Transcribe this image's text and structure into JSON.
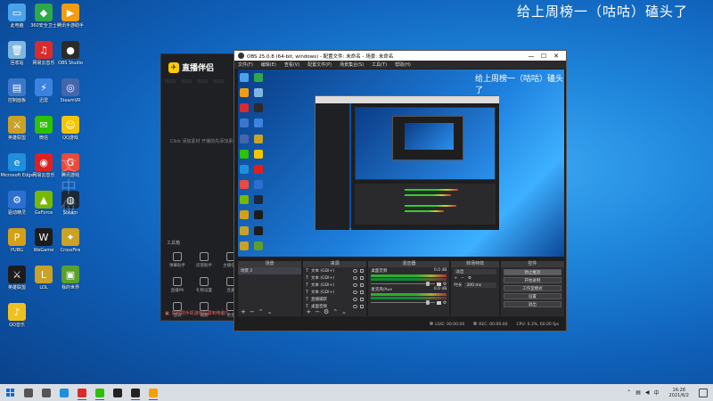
{
  "desktop": {
    "title_overlay": "给上周榜一（咕咕）磕头了",
    "watermark": "文中位",
    "icons": [
      {
        "label": "此电脑",
        "color": "#4aa3e8",
        "glyph": "▭"
      },
      {
        "label": "360安全卫士",
        "color": "#2ea84a",
        "glyph": "◆"
      },
      {
        "label": "腾讯手游助手",
        "color": "#f39c12",
        "glyph": "▶"
      },
      {
        "label": "回收站",
        "color": "#7fb6e0",
        "glyph": "🗑"
      },
      {
        "label": "网易云音乐",
        "color": "#d92b2b",
        "glyph": "♫"
      },
      {
        "label": "OBS Studio",
        "color": "#2b2b2b",
        "glyph": "●"
      },
      {
        "label": "控制面板",
        "color": "#3b78c9",
        "glyph": "▤"
      },
      {
        "label": "迅雷",
        "color": "#3c83e0",
        "glyph": "⚡"
      },
      {
        "label": "SteamVR",
        "color": "#4466aa",
        "glyph": "◎"
      },
      {
        "label": "英雄联盟",
        "color": "#c9a227",
        "glyph": "⚔"
      },
      {
        "label": "微信",
        "color": "#2dc100",
        "glyph": "✉"
      },
      {
        "label": "QQ游戏",
        "color": "#f5c400",
        "glyph": "☺"
      },
      {
        "label": "Microsoft Edge",
        "color": "#1f8fdc",
        "glyph": "e"
      },
      {
        "label": "网易云音乐",
        "color": "#e02020",
        "glyph": "◉"
      },
      {
        "label": "腾讯游戏",
        "color": "#e84a3c",
        "glyph": "G"
      },
      {
        "label": "驱动精灵",
        "color": "#2c6fd1",
        "glyph": "⚙"
      },
      {
        "label": "GeForce",
        "color": "#76b900",
        "glyph": "▲"
      },
      {
        "label": "Steam",
        "color": "#1b2838",
        "glyph": "◍"
      },
      {
        "label": "PUBG",
        "color": "#d4a017",
        "glyph": "P"
      },
      {
        "label": "WeGame",
        "color": "#1c1c1c",
        "glyph": "W"
      },
      {
        "label": "CrossFire",
        "color": "#c9a227",
        "glyph": "✦"
      },
      {
        "label": "英雄联盟",
        "color": "#1c1c1c",
        "glyph": "⚔"
      },
      {
        "label": "LOL",
        "color": "#c9a227",
        "glyph": "L"
      },
      {
        "label": "我的世界",
        "color": "#5aa02c",
        "glyph": "▣"
      },
      {
        "label": "QQ音乐",
        "color": "#f0c020",
        "glyph": "♪"
      }
    ]
  },
  "companion": {
    "logo": "直播伴侣",
    "hint": "Click 添加素材 开播前先添加素材",
    "section": "工具箱",
    "tools": [
      "弹幕助手",
      "房管助手",
      "主播任务",
      "直播PK",
      "礼物设置",
      "连麦",
      "音效",
      "视频",
      "更多"
    ],
    "footer": "如何把手机游戏投屏到电脑？"
  },
  "obs": {
    "title": "OBS 25.0.8 (64-bit, windows) - 配置文件: 未命名 - 场景: 未命名",
    "menu": [
      "文件(F)",
      "编辑(E)",
      "查看(V)",
      "配置文件(P)",
      "场景集合(S)",
      "工具(T)",
      "帮助(H)"
    ],
    "preview_title": "给上周榜一（咕咕）磕头了",
    "docks": {
      "scenes_label": "场景",
      "scenes": [
        "场景 2"
      ],
      "sources_label": "来源",
      "sources": [
        "文本 (GDI+)",
        "文本 (GDI+)",
        "文本 (GDI+)",
        "文本 (GDI+)",
        "直播捕获",
        "桌面音频"
      ],
      "mixer_label": "混音器",
      "mixer": [
        {
          "name": "桌面音频",
          "db": "0.0 dB"
        },
        {
          "name": "麦克风/Aux",
          "db": "0.0 dB"
        }
      ],
      "transitions_label": "转场特效",
      "transition": "淡出",
      "duration_label": "时长",
      "duration": "300 ms",
      "controls_label": "控件",
      "controls": [
        "停止推流",
        "开始录制",
        "工作室模式",
        "设置",
        "退出"
      ]
    },
    "status": {
      "live": "LIVE: 00:00:00",
      "rec": "REC: 00:00:00",
      "cpu": "CPU: 0.3%, 60.00 fps"
    }
  },
  "taskbar": {
    "time": "16:28",
    "date": "2021/6/2",
    "lang": "中",
    "apps": [
      {
        "name": "search",
        "color": "#555",
        "open": false
      },
      {
        "name": "task-view",
        "color": "#555",
        "open": false
      },
      {
        "name": "edge",
        "color": "#1f8fdc",
        "open": false
      },
      {
        "name": "netease-music",
        "color": "#d92b2b",
        "open": true
      },
      {
        "name": "wechat",
        "color": "#2dc100",
        "open": true
      },
      {
        "name": "qq",
        "color": "#222",
        "open": false
      },
      {
        "name": "obs",
        "color": "#222",
        "open": true
      },
      {
        "name": "companion",
        "color": "#f5a000",
        "open": true
      }
    ]
  }
}
